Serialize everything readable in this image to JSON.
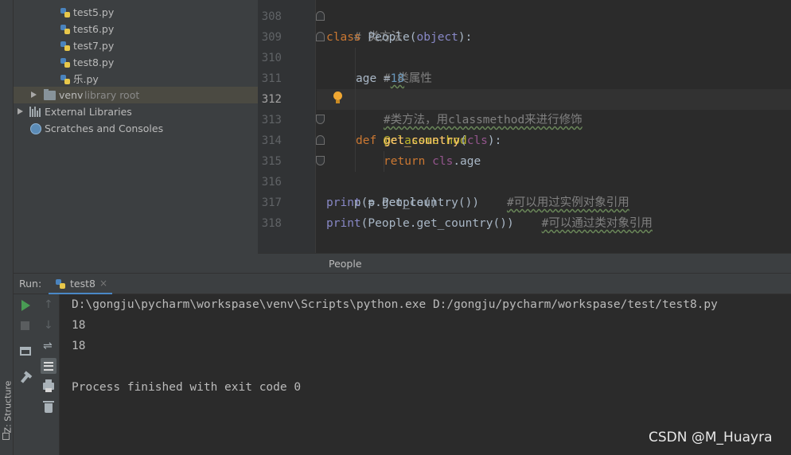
{
  "project_tree": {
    "files": [
      {
        "label": "test5.py"
      },
      {
        "label": "test6.py"
      },
      {
        "label": "test7.py"
      },
      {
        "label": "test8.py"
      },
      {
        "label": "乐.py"
      }
    ],
    "venv": {
      "label": "venv",
      "hint": "library root"
    },
    "external_libraries": "External Libraries",
    "scratches": "Scratches and Consoles"
  },
  "side_tab": {
    "structure": "Z: Structure"
  },
  "editor": {
    "line_numbers": [
      "308",
      "309",
      "310",
      "311",
      "312",
      "313",
      "314",
      "315",
      "316",
      "317",
      "318"
    ],
    "current_line": "312",
    "code": {
      "l308": "# 类方法",
      "l309_kw": "class",
      "l309_name": "People",
      "l309_open": "(",
      "l309_base": "object",
      "l309_close": "):",
      "l310": "# 类属性",
      "l311_a": "age =",
      "l311_num": "18",
      "l312": "#类方法，用classmethod来进行修饰",
      "l313": "@classmethod",
      "l314_kw": "def",
      "l314_fn": "get_country",
      "l314_open": "(",
      "l314_cls": "cls",
      "l314_close": "):",
      "l315_kw": "return",
      "l315_cls": "cls",
      "l315_rest": ".age",
      "l316": "p = People()",
      "l317_fn": "print",
      "l317_args": "(p.get_country())",
      "l317_cm": "#可以用过实例对象引用",
      "l318_fn": "print",
      "l318_args": "(People.get_country())",
      "l318_cm": "#可以通过类对象引用"
    }
  },
  "breadcrumb": {
    "item": "People"
  },
  "run_panel": {
    "title": "Run:",
    "tab": "test8",
    "close": "×",
    "output": [
      "D:\\gongju\\pycharm\\workspase\\venv\\Scripts\\python.exe D:/gongju/pycharm/workspase/test/test8.py",
      "18",
      "18",
      "",
      "Process finished with exit code 0"
    ]
  },
  "watermark": "CSDN @M_Huayra",
  "icons": {
    "run": "play-icon",
    "stop": "stop-icon",
    "up": "arrow-up-icon",
    "down": "arrow-down-icon"
  }
}
